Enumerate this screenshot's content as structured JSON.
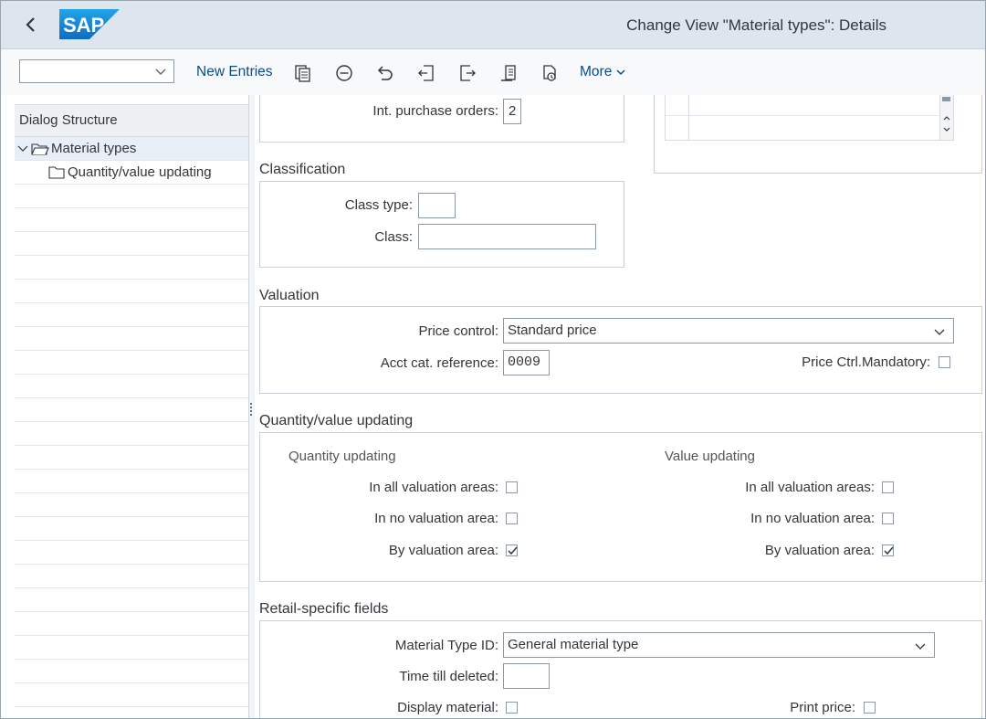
{
  "header": {
    "title": "Change View \"Material types\": Details",
    "logo": "SAP"
  },
  "toolbar": {
    "command_field": "",
    "new_entries": "New Entries",
    "more": "More",
    "icons": [
      "copy-icon",
      "delete-icon",
      "undo-icon",
      "previous-entry-icon",
      "next-entry-icon",
      "select-all-icon",
      "transport-icon"
    ]
  },
  "dialog_structure": {
    "title": "Dialog Structure",
    "items": [
      {
        "label": "Material types"
      },
      {
        "label": "Quantity/value updating"
      }
    ]
  },
  "purchase": {
    "int_po_label": "Int. purchase orders:",
    "int_po_value": "2"
  },
  "classification": {
    "title": "Classification",
    "class_type_label": "Class type:",
    "class_type_value": "",
    "class_label": "Class:",
    "class_value": ""
  },
  "valuation": {
    "title": "Valuation",
    "price_control_label": "Price control:",
    "price_control_value": "Standard price",
    "acct_cat_label": "Acct cat. reference:",
    "acct_cat_value": "0009",
    "price_ctrl_mandatory_label": "Price Ctrl.Mandatory:",
    "price_ctrl_mandatory_checked": false
  },
  "qv_updating": {
    "title": "Quantity/value updating",
    "quantity": {
      "title": "Quantity updating",
      "all_label": "In all valuation areas:",
      "all_checked": false,
      "no_label": "In no valuation area:",
      "no_checked": false,
      "by_label": "By valuation area:",
      "by_checked": true
    },
    "value": {
      "title": "Value updating",
      "all_label": "In all valuation areas:",
      "all_checked": false,
      "no_label": "In no valuation area:",
      "no_checked": false,
      "by_label": "By valuation area:",
      "by_checked": true
    }
  },
  "retail": {
    "title": "Retail-specific fields",
    "mat_type_id_label": "Material Type ID:",
    "mat_type_id_value": "General material type",
    "time_till_deleted_label": "Time till deleted:",
    "time_till_deleted_value": "",
    "display_material_label": "Display material:",
    "display_material_checked": false,
    "print_price_label": "Print price:",
    "print_price_checked": false
  },
  "colors": {
    "shell_bg": "#dde6ef",
    "link": "#0a4b8c",
    "sap_blue": "#1b7ccf"
  }
}
